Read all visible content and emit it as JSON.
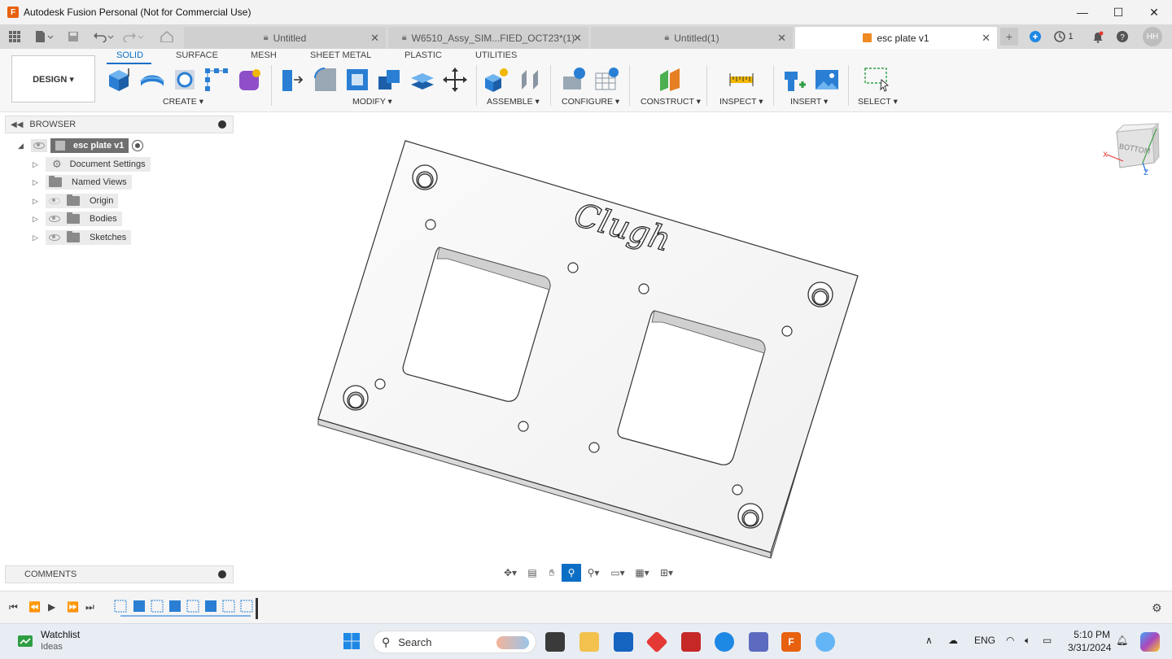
{
  "window": {
    "title": "Autodesk Fusion Personal (Not for Commercial Use)",
    "app_logo": "F",
    "minimize": "—",
    "maximize": "☐",
    "close": "✕"
  },
  "tabs": [
    {
      "label": "Untitled",
      "locked": true,
      "active": false
    },
    {
      "label": "W6510_Assy_SIM...FIED_OCT23*(1)",
      "locked": true,
      "active": false
    },
    {
      "label": "Untitled(1)",
      "locked": true,
      "active": false
    },
    {
      "label": "esc plate v1",
      "locked": false,
      "active": true
    }
  ],
  "tabbar_right": {
    "jobs_count": "1",
    "user_initials": "HH"
  },
  "toolbar": {
    "workspace_button": "DESIGN ▾",
    "workspace_tabs": [
      "SOLID",
      "SURFACE",
      "MESH",
      "SHEET METAL",
      "PLASTIC",
      "UTILITIES"
    ],
    "active_tab": "SOLID",
    "groups": {
      "create": "CREATE ▾",
      "modify": "MODIFY ▾",
      "assemble": "ASSEMBLE ▾",
      "configure": "CONFIGURE ▾",
      "construct": "CONSTRUCT ▾",
      "inspect": "INSPECT ▾",
      "insert": "INSERT ▾",
      "select": "SELECT ▾"
    }
  },
  "browser": {
    "header": "BROWSER",
    "root": "esc plate v1",
    "items": [
      {
        "label": "Document Settings",
        "icon": "gear-icon"
      },
      {
        "label": "Named Views",
        "icon": "folder-icon"
      },
      {
        "label": "Origin",
        "icon": "folder-icon"
      },
      {
        "label": "Bodies",
        "icon": "folder-icon"
      },
      {
        "label": "Sketches",
        "icon": "folder-icon"
      }
    ]
  },
  "comments": {
    "header": "COMMENTS"
  },
  "viewport": {
    "model_engraving": "Clugh",
    "viewcube_face": "BOTTOM",
    "axis_x": "X",
    "axis_z": "Z"
  },
  "taskbar": {
    "widget_title": "Watchlist",
    "widget_subtitle": "Ideas",
    "search_placeholder": "Search",
    "language": "ENG",
    "time": "5:10 PM",
    "date": "3/31/2024"
  }
}
